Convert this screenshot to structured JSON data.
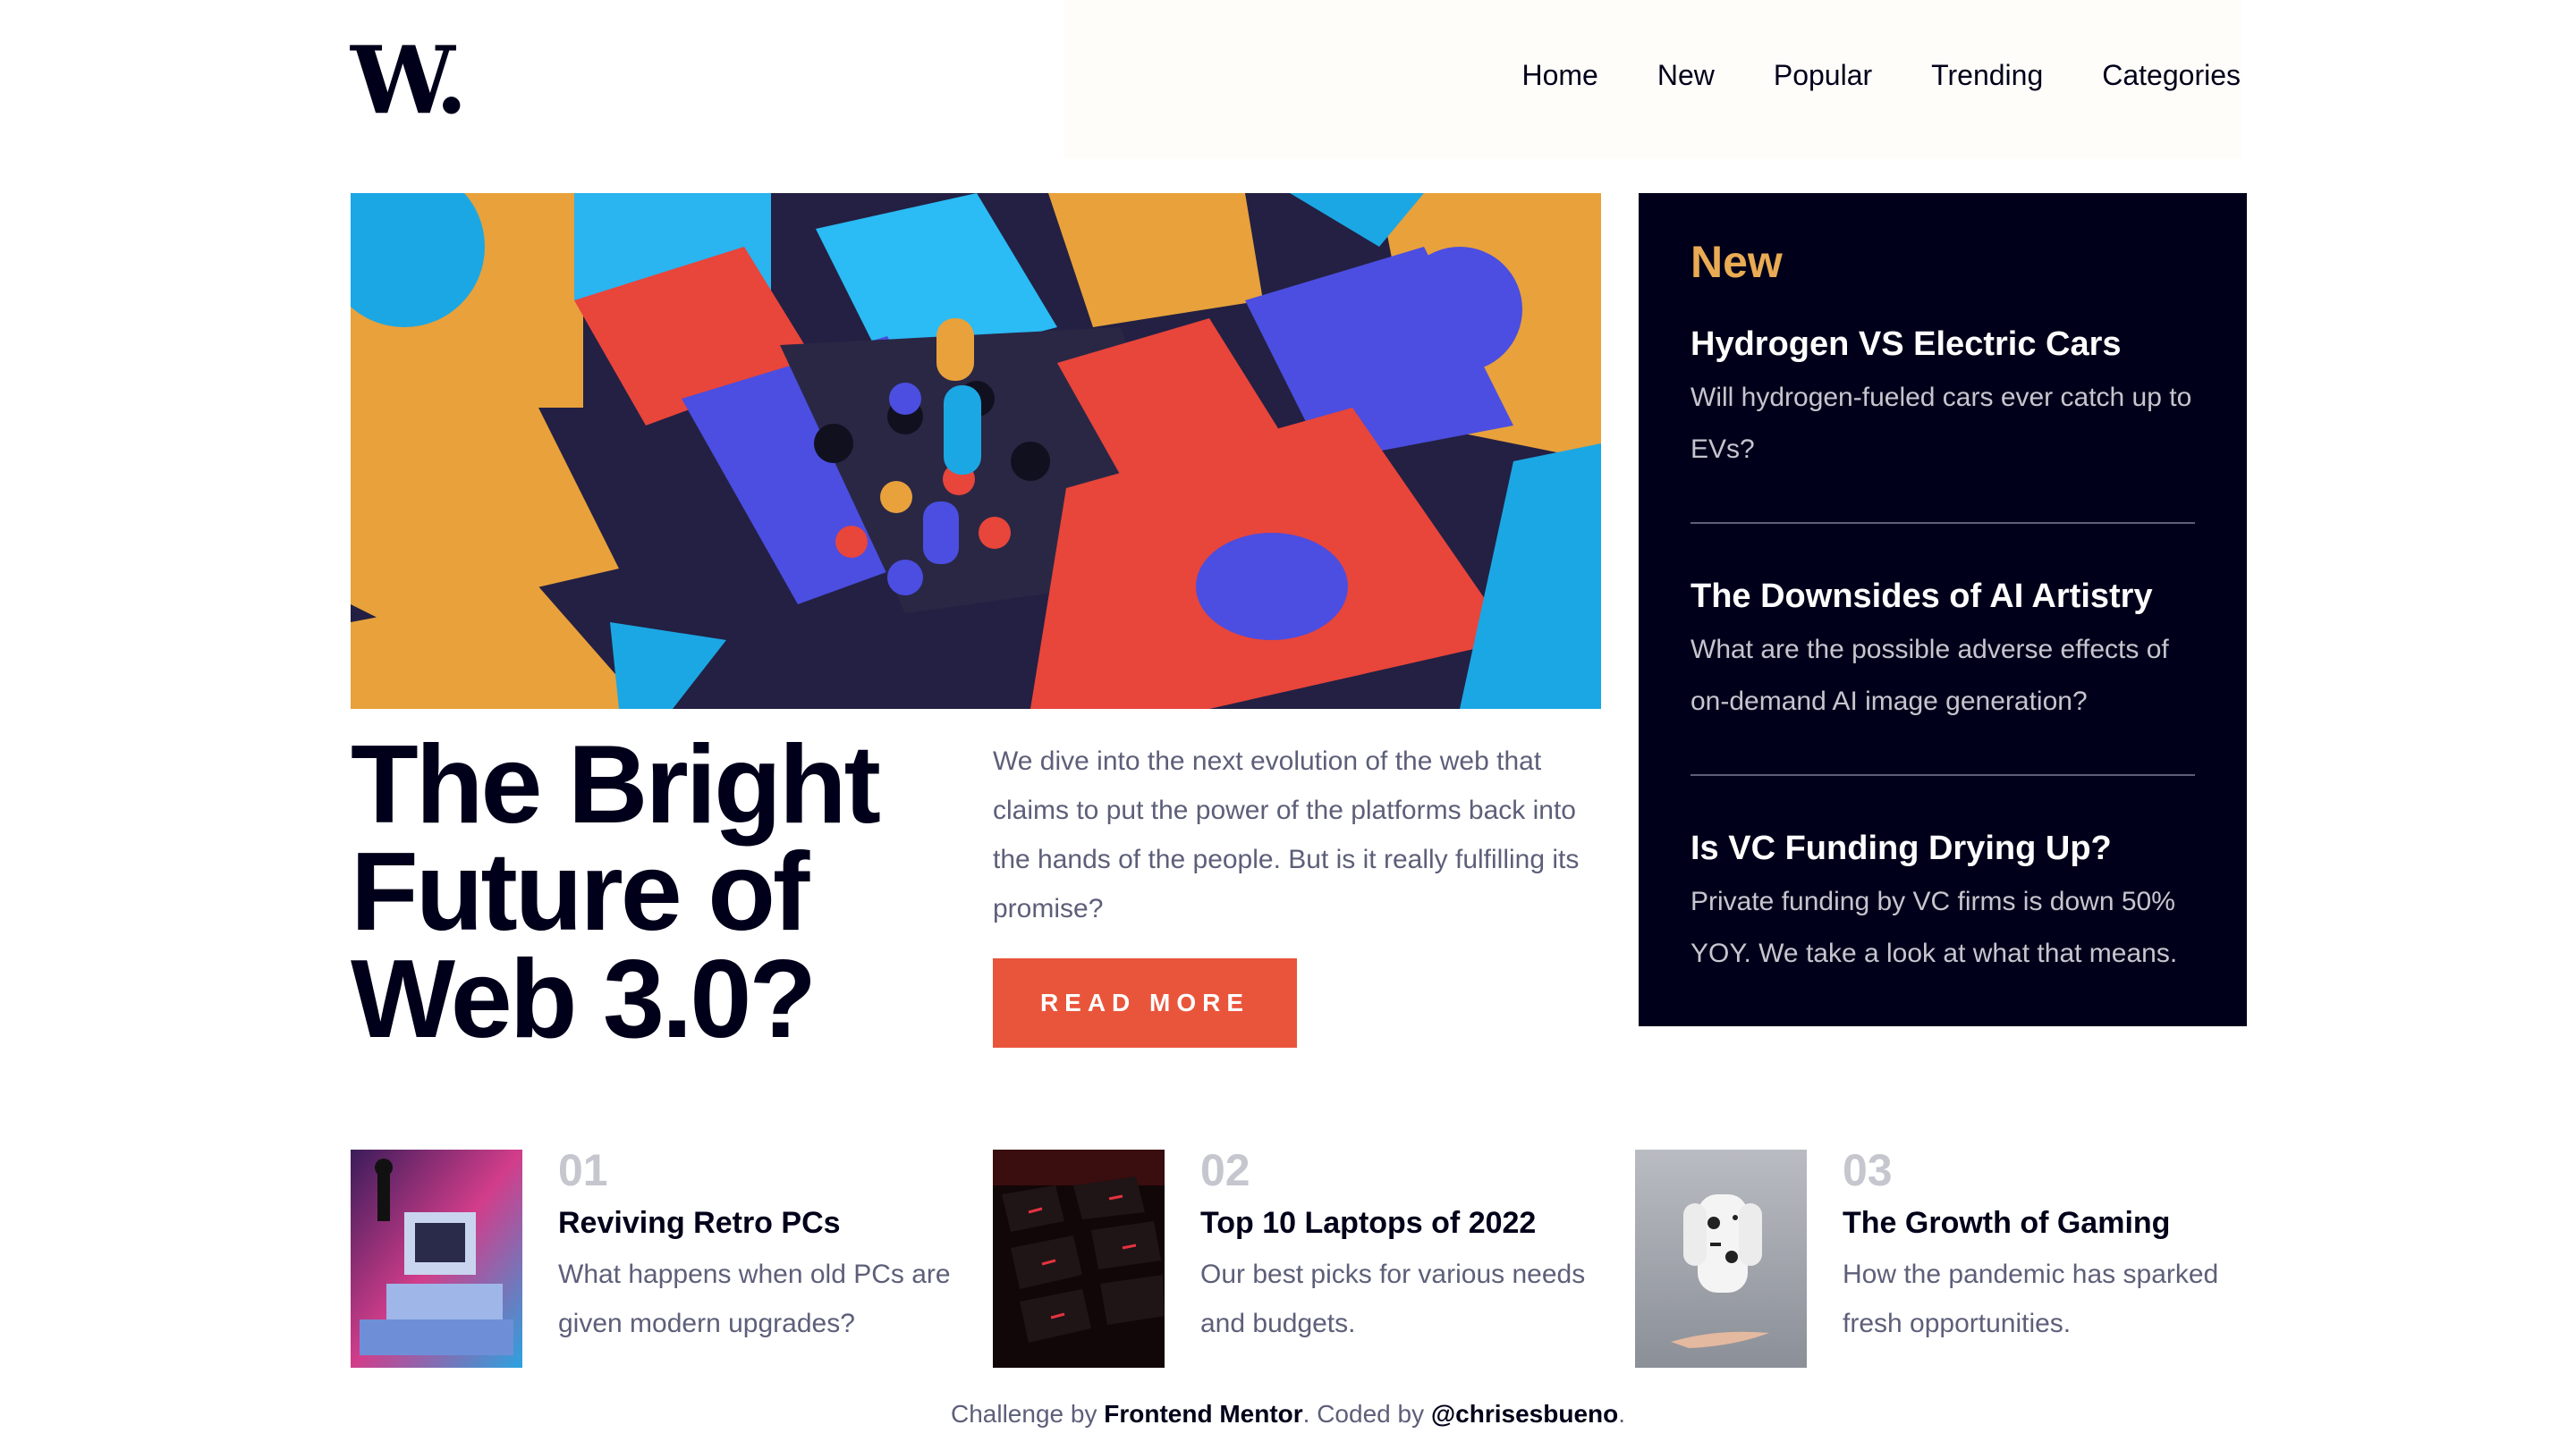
{
  "logo": "W.",
  "nav": [
    "Home",
    "New",
    "Popular",
    "Trending",
    "Categories"
  ],
  "hero": {
    "title_lines": [
      "The Bright",
      "Future of",
      "Web 3.0?"
    ],
    "description": "We dive into the next evolution of the web that claims to put the power of the platforms back into the hands of the people. But is it really fulfilling its promise?",
    "button_label": "READ MORE"
  },
  "new_panel": {
    "heading": "New",
    "items": [
      {
        "title": "Hydrogen VS Electric Cars",
        "desc": "Will hydrogen-fueled cars ever catch up to EVs?"
      },
      {
        "title": "The Downsides of AI Artistry",
        "desc": "What are the possible adverse effects of on-demand AI image generation?"
      },
      {
        "title": "Is VC Funding Drying Up?",
        "desc": "Private funding by VC firms is down 50% YOY. We take a look at what that means."
      }
    ]
  },
  "cards": [
    {
      "num": "01",
      "title": "Reviving Retro PCs",
      "desc": "What happens when old PCs are given modern upgrades?"
    },
    {
      "num": "02",
      "title": "Top 10 Laptops of 2022",
      "desc": "Our best picks for various needs and budgets."
    },
    {
      "num": "03",
      "title": "The Growth of Gaming",
      "desc": "How the pandemic has sparked fresh opportunities."
    }
  ],
  "footer": {
    "prefix": "Challenge by ",
    "link1": "Frontend Mentor",
    "middle": ". Coded by ",
    "link2": "@chrisesbueno",
    "suffix": "."
  },
  "colors": {
    "dark": "#00001a",
    "accent": "#e9553b",
    "gold": "#e9ab53",
    "gray": "#5d5f79",
    "light_gray": "#c5c6ce"
  }
}
